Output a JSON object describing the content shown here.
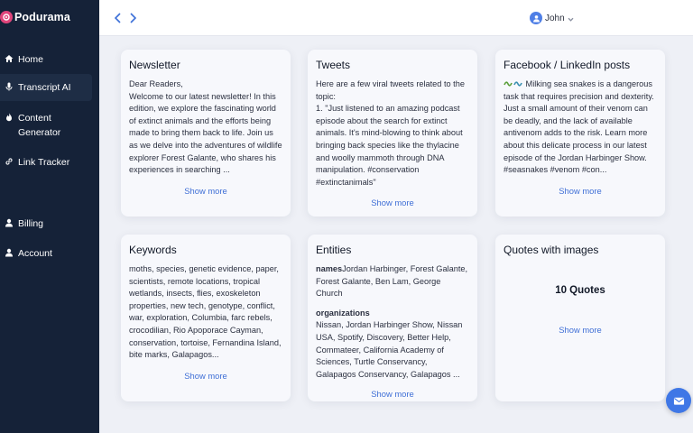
{
  "brand": {
    "name": "Podurama"
  },
  "sidebar": {
    "items": [
      {
        "label": "Home",
        "icon": "home-icon"
      },
      {
        "label": "Transcript AI",
        "icon": "microphone-icon"
      },
      {
        "label": "Content\nGenerator",
        "icon": "flame-icon"
      },
      {
        "label": "Link Tracker",
        "icon": "link-icon"
      },
      {
        "label": "Billing",
        "icon": "user-icon"
      },
      {
        "label": "Account",
        "icon": "user-icon"
      }
    ]
  },
  "header": {
    "user_name": "John"
  },
  "cards": {
    "newsletter": {
      "title": "Newsletter",
      "body": "Dear Readers,\nWelcome to our latest newsletter! In this edition, we explore the fascinating world of extinct animals and the efforts being made to bring them back to life. Join us as we delve into the adventures of wildlife explorer Forest Galante, who shares his experiences in searching ...",
      "show_more": "Show more"
    },
    "tweets": {
      "title": "Tweets",
      "body": "Here are a few viral tweets related to the topic:\n1. \"Just listened to an amazing podcast episode about the search for extinct animals. It's mind-blowing to think about bringing back species like the thylacine and woolly mammoth through DNA manipulation. #conservation #extinctanimals\"",
      "show_more": "Show more"
    },
    "facebook": {
      "title": "Facebook / LinkedIn posts",
      "body": " Milking sea snakes is a dangerous task that requires precision and dexterity. Just a small amount of their venom can be deadly, and the lack of available antivenom adds to the risk. Learn more about this delicate process in our latest episode of the Jordan Harbinger Show. #seasnakes #venom #con...",
      "show_more": "Show more"
    },
    "keywords": {
      "title": "Keywords",
      "body": "moths, species, genetic evidence, paper, scientists, remote locations, tropical wetlands, insects, flies, exoskeleton properties, new tech, genotype, conflict, war, exploration, Columbia, farc rebels, crocodilian, Rio Apoporace Cayman, conservation, tortoise, Fernandina Island, bite marks, Galapagos...",
      "show_more": "Show more"
    },
    "entities": {
      "title": "Entities",
      "names_label": "names",
      "names_value": "Jordan Harbinger, Forest Galante, Forest Galante, Ben Lam, George Church",
      "org_label": "organizations",
      "org_value": "Nissan, Jordan Harbinger Show, Nissan USA, Spotify, Discovery, Better Help, Commateer, California Academy of Sciences, Turtle Conservancy, Galapagos Conservancy, Galapagos ...",
      "show_more": "Show more"
    },
    "quotes": {
      "title": "Quotes with images",
      "count": "10 Quotes",
      "show_more": "Show more"
    }
  },
  "colors": {
    "sidebar_bg": "#152238",
    "accent": "#3f6fd6",
    "brand": "#e0457b"
  }
}
